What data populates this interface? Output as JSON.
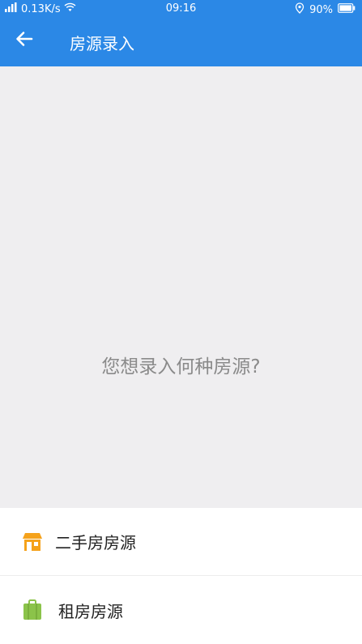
{
  "status_bar": {
    "network": "0.13K/s",
    "time": "09:16",
    "battery": "90%"
  },
  "header": {
    "title": "房源录入",
    "back_icon": "back-arrow-icon"
  },
  "prompt": {
    "text": "您想录入何种房源?"
  },
  "options": [
    {
      "label": "二手房房源",
      "icon": "house-icon",
      "icon_color": "#f5a21b"
    },
    {
      "label": "租房房源",
      "icon": "luggage-icon",
      "icon_color": "#8bc34a"
    }
  ],
  "colors": {
    "primary": "#2b88e6",
    "background": "#efeef0",
    "prompt_text": "#8a8a8a"
  }
}
